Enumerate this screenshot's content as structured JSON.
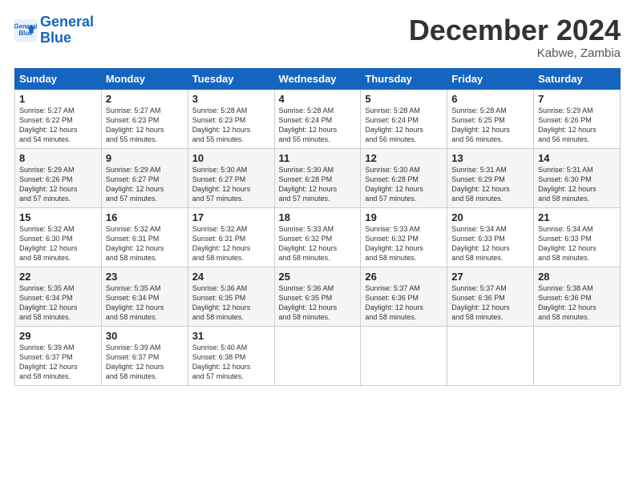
{
  "logo": {
    "line1": "General",
    "line2": "Blue"
  },
  "title": "December 2024",
  "subtitle": "Kabwe, Zambia",
  "days": [
    "Sunday",
    "Monday",
    "Tuesday",
    "Wednesday",
    "Thursday",
    "Friday",
    "Saturday"
  ],
  "weeks": [
    [
      {
        "day": "1",
        "text": "Sunrise: 5:27 AM\nSunset: 6:22 PM\nDaylight: 12 hours\nand 54 minutes."
      },
      {
        "day": "2",
        "text": "Sunrise: 5:27 AM\nSunset: 6:23 PM\nDaylight: 12 hours\nand 55 minutes."
      },
      {
        "day": "3",
        "text": "Sunrise: 5:28 AM\nSunset: 6:23 PM\nDaylight: 12 hours\nand 55 minutes."
      },
      {
        "day": "4",
        "text": "Sunrise: 5:28 AM\nSunset: 6:24 PM\nDaylight: 12 hours\nand 55 minutes."
      },
      {
        "day": "5",
        "text": "Sunrise: 5:28 AM\nSunset: 6:24 PM\nDaylight: 12 hours\nand 56 minutes."
      },
      {
        "day": "6",
        "text": "Sunrise: 5:28 AM\nSunset: 6:25 PM\nDaylight: 12 hours\nand 56 minutes."
      },
      {
        "day": "7",
        "text": "Sunrise: 5:29 AM\nSunset: 6:26 PM\nDaylight: 12 hours\nand 56 minutes."
      }
    ],
    [
      {
        "day": "8",
        "text": "Sunrise: 5:29 AM\nSunset: 6:26 PM\nDaylight: 12 hours\nand 57 minutes."
      },
      {
        "day": "9",
        "text": "Sunrise: 5:29 AM\nSunset: 6:27 PM\nDaylight: 12 hours\nand 57 minutes."
      },
      {
        "day": "10",
        "text": "Sunrise: 5:30 AM\nSunset: 6:27 PM\nDaylight: 12 hours\nand 57 minutes."
      },
      {
        "day": "11",
        "text": "Sunrise: 5:30 AM\nSunset: 6:28 PM\nDaylight: 12 hours\nand 57 minutes."
      },
      {
        "day": "12",
        "text": "Sunrise: 5:30 AM\nSunset: 6:28 PM\nDaylight: 12 hours\nand 57 minutes."
      },
      {
        "day": "13",
        "text": "Sunrise: 5:31 AM\nSunset: 6:29 PM\nDaylight: 12 hours\nand 58 minutes."
      },
      {
        "day": "14",
        "text": "Sunrise: 5:31 AM\nSunset: 6:30 PM\nDaylight: 12 hours\nand 58 minutes."
      }
    ],
    [
      {
        "day": "15",
        "text": "Sunrise: 5:32 AM\nSunset: 6:30 PM\nDaylight: 12 hours\nand 58 minutes."
      },
      {
        "day": "16",
        "text": "Sunrise: 5:32 AM\nSunset: 6:31 PM\nDaylight: 12 hours\nand 58 minutes."
      },
      {
        "day": "17",
        "text": "Sunrise: 5:32 AM\nSunset: 6:31 PM\nDaylight: 12 hours\nand 58 minutes."
      },
      {
        "day": "18",
        "text": "Sunrise: 5:33 AM\nSunset: 6:32 PM\nDaylight: 12 hours\nand 58 minutes."
      },
      {
        "day": "19",
        "text": "Sunrise: 5:33 AM\nSunset: 6:32 PM\nDaylight: 12 hours\nand 58 minutes."
      },
      {
        "day": "20",
        "text": "Sunrise: 5:34 AM\nSunset: 6:33 PM\nDaylight: 12 hours\nand 58 minutes."
      },
      {
        "day": "21",
        "text": "Sunrise: 5:34 AM\nSunset: 6:33 PM\nDaylight: 12 hours\nand 58 minutes."
      }
    ],
    [
      {
        "day": "22",
        "text": "Sunrise: 5:35 AM\nSunset: 6:34 PM\nDaylight: 12 hours\nand 58 minutes."
      },
      {
        "day": "23",
        "text": "Sunrise: 5:35 AM\nSunset: 6:34 PM\nDaylight: 12 hours\nand 58 minutes."
      },
      {
        "day": "24",
        "text": "Sunrise: 5:36 AM\nSunset: 6:35 PM\nDaylight: 12 hours\nand 58 minutes."
      },
      {
        "day": "25",
        "text": "Sunrise: 5:36 AM\nSunset: 6:35 PM\nDaylight: 12 hours\nand 58 minutes."
      },
      {
        "day": "26",
        "text": "Sunrise: 5:37 AM\nSunset: 6:36 PM\nDaylight: 12 hours\nand 58 minutes."
      },
      {
        "day": "27",
        "text": "Sunrise: 5:37 AM\nSunset: 6:36 PM\nDaylight: 12 hours\nand 58 minutes."
      },
      {
        "day": "28",
        "text": "Sunrise: 5:38 AM\nSunset: 6:36 PM\nDaylight: 12 hours\nand 58 minutes."
      }
    ],
    [
      {
        "day": "29",
        "text": "Sunrise: 5:39 AM\nSunset: 6:37 PM\nDaylight: 12 hours\nand 58 minutes."
      },
      {
        "day": "30",
        "text": "Sunrise: 5:39 AM\nSunset: 6:37 PM\nDaylight: 12 hours\nand 58 minutes."
      },
      {
        "day": "31",
        "text": "Sunrise: 5:40 AM\nSunset: 6:38 PM\nDaylight: 12 hours\nand 57 minutes."
      },
      null,
      null,
      null,
      null
    ]
  ]
}
